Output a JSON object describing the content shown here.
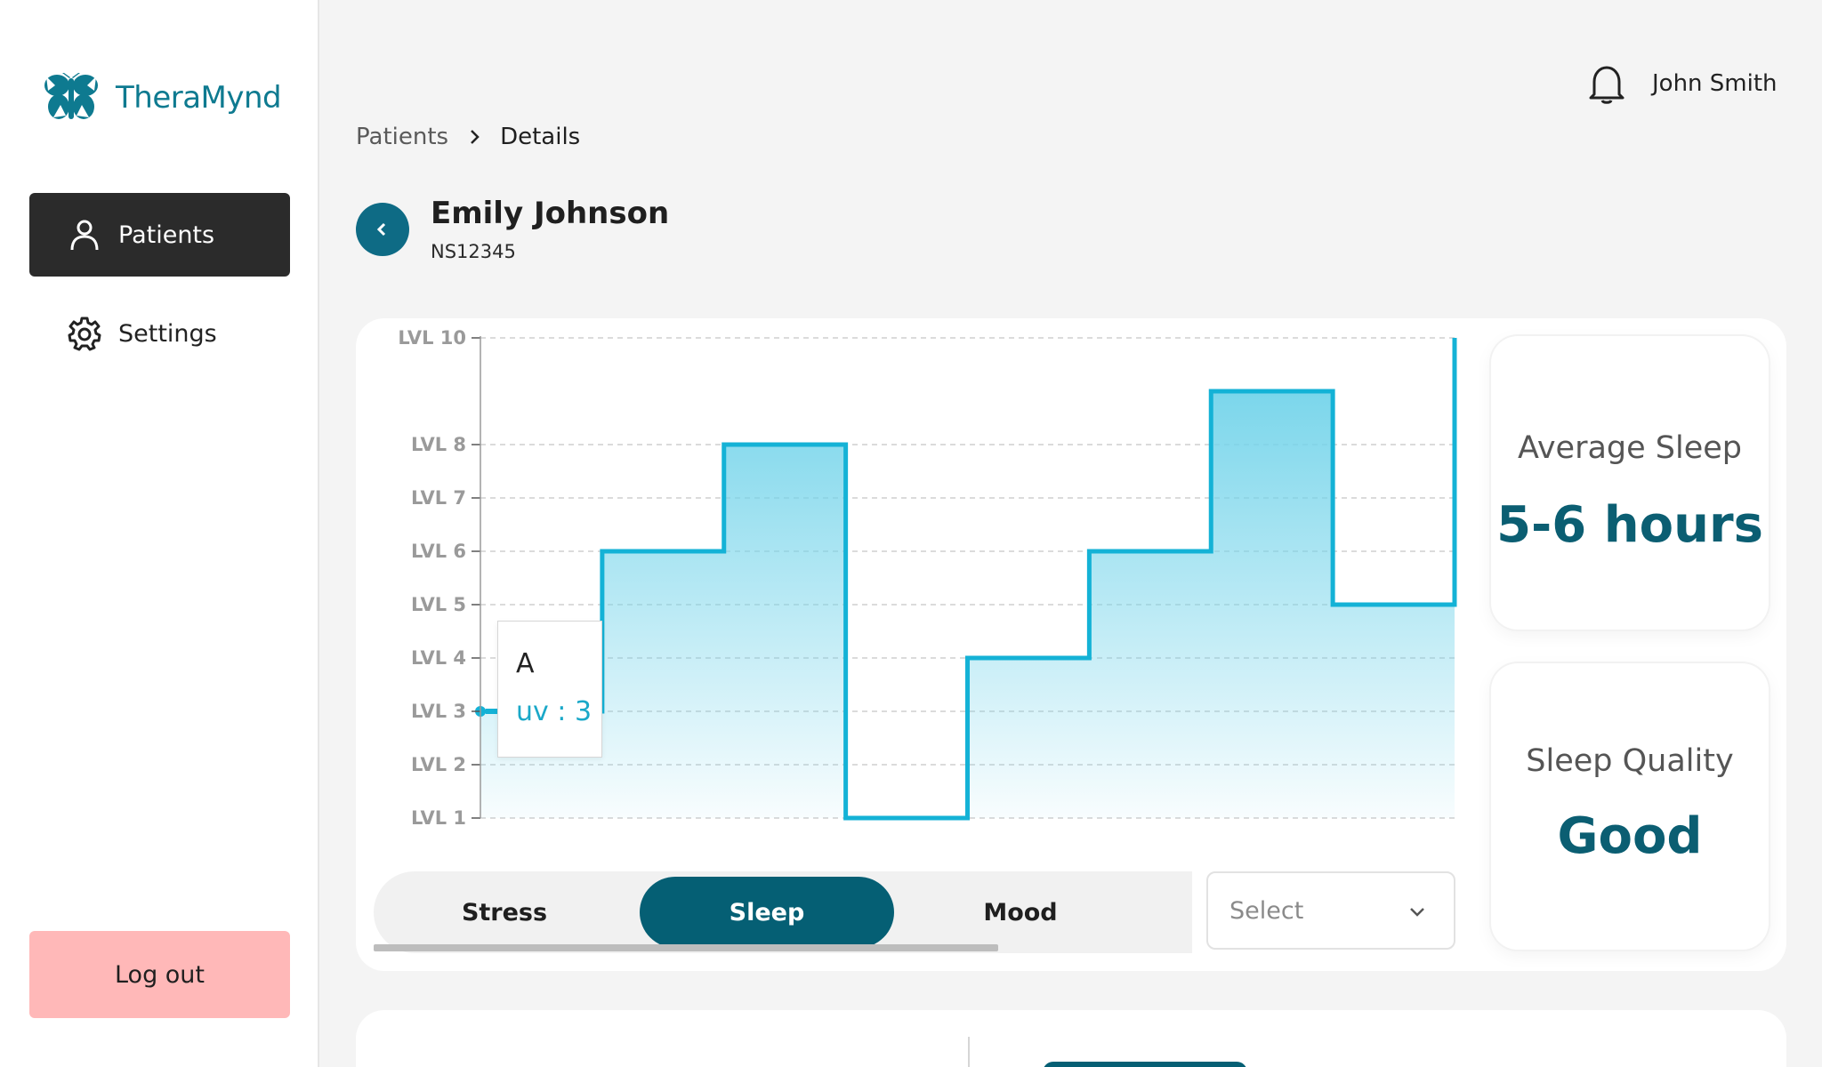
{
  "app": {
    "name": "TheraMynd",
    "brand_color": "#0e7a90",
    "accent_color": "#055f74"
  },
  "sidebar": {
    "items": [
      {
        "label": "Patients",
        "icon": "user-icon",
        "active": true
      },
      {
        "label": "Settings",
        "icon": "gear-icon",
        "active": false
      }
    ],
    "logout_label": "Log out"
  },
  "header": {
    "user_name": "John Smith",
    "notification_icon": "bell-icon"
  },
  "breadcrumb": {
    "parent": "Patients",
    "current": "Details"
  },
  "patient": {
    "name": "Emily Johnson",
    "id": "NS12345"
  },
  "tabs": [
    {
      "label": "Stress",
      "active": false
    },
    {
      "label": "Sleep",
      "active": true
    },
    {
      "label": "Mood",
      "active": false
    }
  ],
  "select": {
    "placeholder": "Select"
  },
  "stats": {
    "average_sleep": {
      "label": "Average Sleep",
      "value": "5-6 hours"
    },
    "sleep_quality": {
      "label": "Sleep Quality",
      "value": "Good"
    }
  },
  "tooltip": {
    "label": "A",
    "value_text": "uv : 3"
  },
  "chart_data": {
    "type": "area",
    "interpolation": "step",
    "y_ticks": [
      1,
      2,
      3,
      4,
      5,
      6,
      7,
      8,
      10
    ],
    "y_tick_labels": [
      "LVL 1",
      "LVL 2",
      "LVL 3",
      "LVL 4",
      "LVL 5",
      "LVL 6",
      "LVL 7",
      "LVL 8",
      "LVL 10"
    ],
    "ylim": [
      1,
      10
    ],
    "grid": true,
    "series": [
      {
        "values": [
          3,
          6,
          8,
          1,
          4,
          6,
          9,
          5
        ],
        "color": "#14b2d6"
      }
    ]
  }
}
